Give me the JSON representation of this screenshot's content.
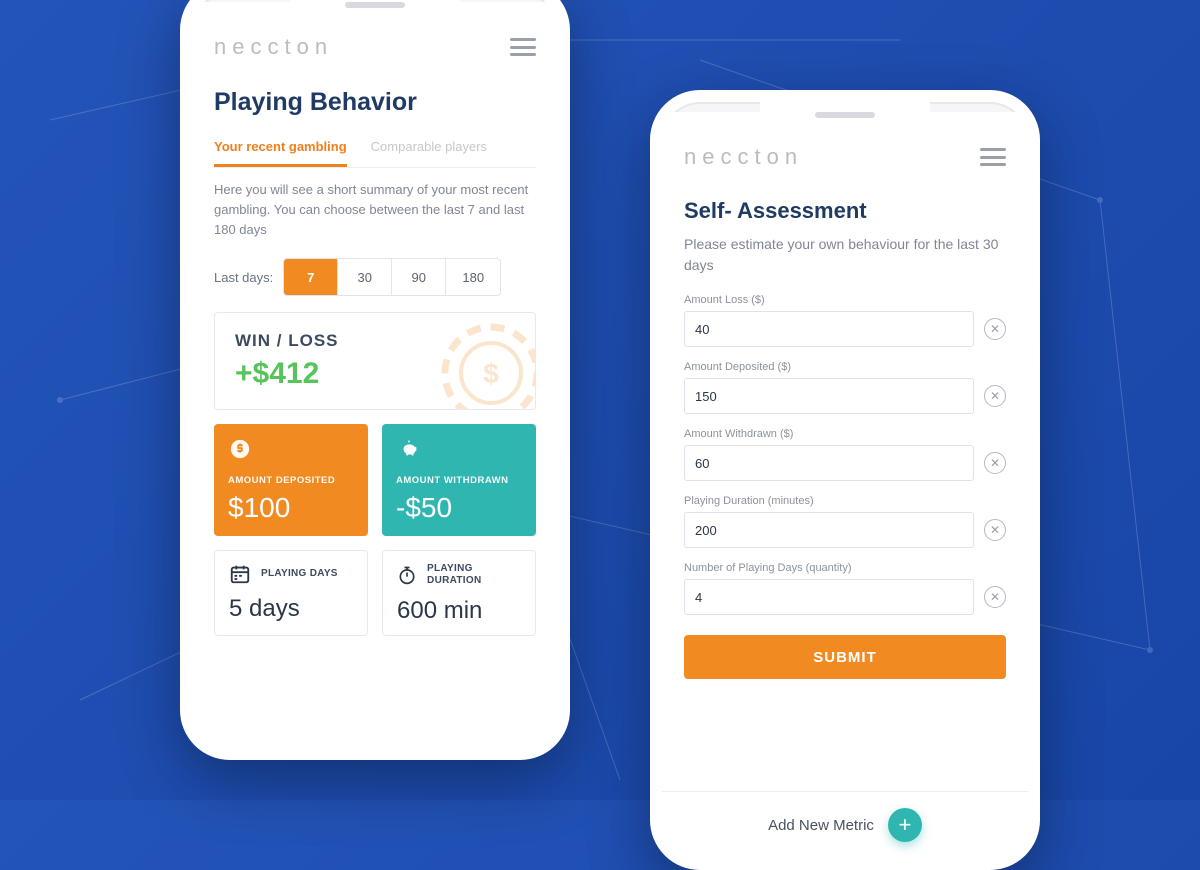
{
  "brand": "neccton",
  "left": {
    "title": "Playing Behavior",
    "tabs": {
      "active": "Your recent gambling",
      "other": "Comparable players"
    },
    "description": "Here you will see a short summary of your most recent gambling. You can choose between the last 7 and last 180 days",
    "daysLabel": "Last days:",
    "days": [
      "7",
      "30",
      "90",
      "180"
    ],
    "daysActive": "7",
    "winloss": {
      "label": "WIN / LOSS",
      "value": "+$412"
    },
    "deposited": {
      "caption": "AMOUNT DEPOSITED",
      "value": "$100"
    },
    "withdrawn": {
      "caption": "AMOUNT WITHDRAWN",
      "value": "-$50"
    },
    "playingDays": {
      "caption": "PLAYING DAYS",
      "value": "5 days"
    },
    "playingDuration": {
      "caption": "PLAYING DURATION",
      "value": "600 min"
    }
  },
  "right": {
    "title": "Self- Assessment",
    "lead": "Please estimate your own behaviour for the last 30 days",
    "fields": [
      {
        "label": "Amount Loss ($)",
        "value": "40"
      },
      {
        "label": "Amount Deposited ($)",
        "value": "150"
      },
      {
        "label": "Amount Withdrawn ($)",
        "value": "60"
      },
      {
        "label": "Playing Duration (minutes)",
        "value": "200"
      },
      {
        "label": "Number of Playing Days (quantity)",
        "value": "4"
      }
    ],
    "submit": "SUBMIT",
    "addMetric": "Add New Metric"
  },
  "colors": {
    "orange": "#f28a22",
    "teal": "#2fb6b0",
    "green": "#58c35a"
  }
}
